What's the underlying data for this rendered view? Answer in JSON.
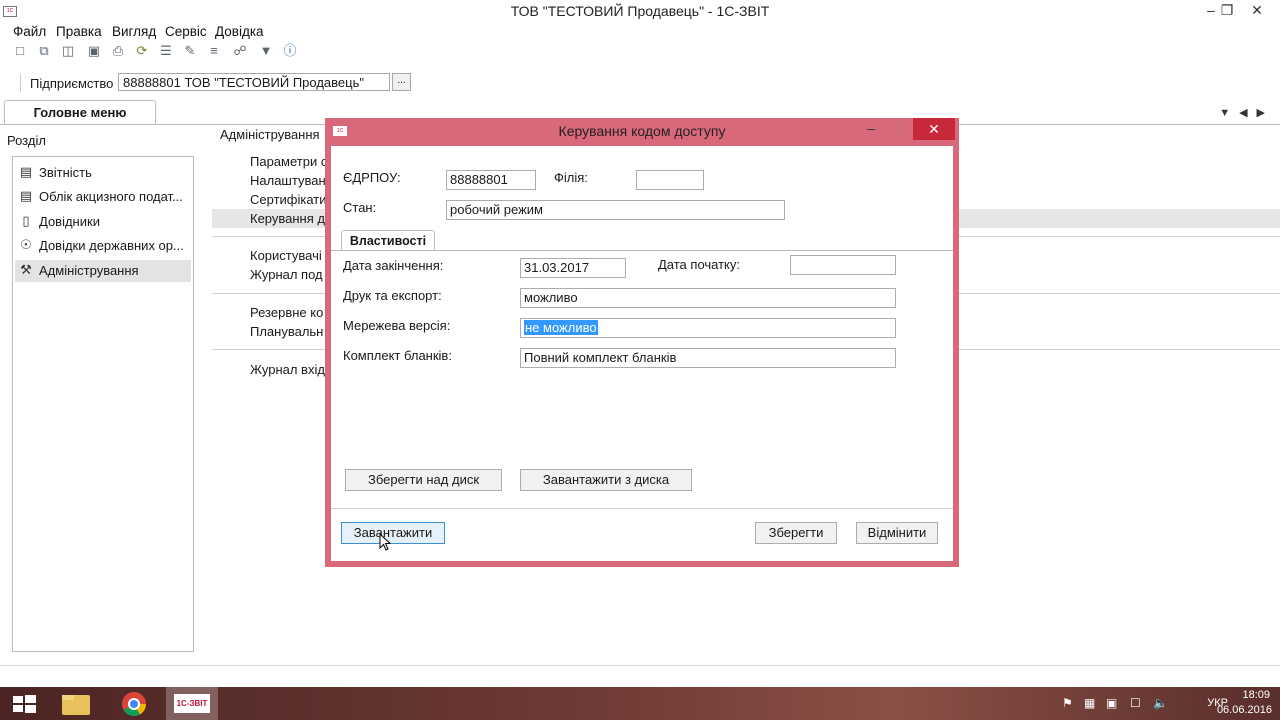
{
  "window": {
    "title": "ТОВ \"ТЕСТОВИЙ Продавець\" - 1С-ЗВІТ"
  },
  "menu": [
    "Файл",
    "Правка",
    "Вигляд",
    "Сервіс",
    "Довідка"
  ],
  "enterprise": {
    "label": "Підприємство",
    "value": "88888801  ТОВ \"ТЕСТОВИЙ Продавець\"",
    "button": "..."
  },
  "main_tab": "Головне меню",
  "sidebar": {
    "heading": "Розділ",
    "items": [
      {
        "label": "Звітність",
        "icon": "document-icon"
      },
      {
        "label": "Облік акцизного подат...",
        "icon": "excise-icon"
      },
      {
        "label": "Довідники",
        "icon": "book-icon"
      },
      {
        "label": "Довідки державних ор...",
        "icon": "eye-icon"
      },
      {
        "label": "Адміністрування",
        "icon": "tools-icon"
      }
    ]
  },
  "admin": {
    "heading": "Адміністрування",
    "links": [
      "Параметри с",
      "Налаштуван",
      "Сертифікати",
      "Керування д",
      "Користувачі",
      "Журнал под",
      "Резервне ко",
      "Планувальн",
      "Журнал вхід"
    ]
  },
  "dialog": {
    "title": "Керування кодом доступу",
    "edrpou_label": "ЄДРПОУ:",
    "edrpou_value": "88888801",
    "branch_label": "Філія:",
    "branch_value": "",
    "state_label": "Стан:",
    "state_value": "робочий режим",
    "tab": "Властивості",
    "end_date_label": "Дата закінчення:",
    "end_date_value": "31.03.2017",
    "start_date_label": "Дата початку:",
    "start_date_value": "",
    "print_label": "Друк та експорт:",
    "print_value": "можливо",
    "network_label": "Мережева версія:",
    "network_value": "не можливо",
    "forms_label": "Комплект бланків:",
    "forms_value": "Повний комплект бланків",
    "save_disk": "Зберегти над диск",
    "load_disk": "Завантажити з диска",
    "load": "Завантажити",
    "save": "Зберегти",
    "cancel": "Відмінити"
  },
  "taskbar": {
    "lang": "УКР",
    "time": "18:09",
    "date": "06.06.2016",
    "app_label": "1С-ЗВІТ"
  }
}
